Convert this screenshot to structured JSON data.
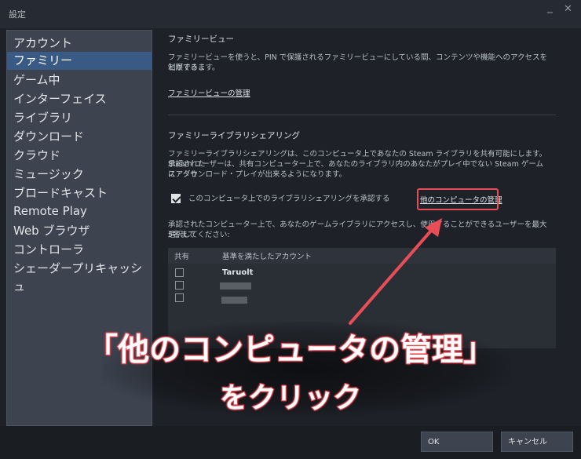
{
  "window": {
    "title": "設定",
    "minimize_glyph": "_",
    "close_glyph": "✕"
  },
  "sidebar": {
    "items": [
      {
        "label": "アカウント",
        "active": false
      },
      {
        "label": "ファミリー",
        "active": true
      },
      {
        "label": "ゲーム中",
        "active": false
      },
      {
        "label": "インターフェイス",
        "active": false
      },
      {
        "label": "ライブラリ",
        "active": false
      },
      {
        "label": "ダウンロード",
        "active": false
      },
      {
        "label": "クラウド",
        "active": false
      },
      {
        "label": "ミュージック",
        "active": false
      },
      {
        "label": "ブロードキャスト",
        "active": false
      },
      {
        "label": "Remote Play",
        "active": false
      },
      {
        "label": "Web ブラウザ",
        "active": false
      },
      {
        "label": "コントローラ",
        "active": false
      },
      {
        "label": "シェーダープリキャッシュ",
        "active": false
      }
    ]
  },
  "family_view": {
    "heading": "ファミリービュー",
    "description_line1": "ファミリービューを使うと、PIN で保護されるファミリービューにしている間、コンテンツや機能へのアクセスを制限するこ",
    "description_line2": "とができます。",
    "manage_link": "ファミリービューの管理"
  },
  "family_sharing": {
    "heading": "ファミリーライブラリシェアリング",
    "description_line1": "ファミリーライブラリシェアリングは、このコンピュータ上であなたの Steam ライブラリを共有可能にします。承認された",
    "description_line2": "Steam ユーザーは、共有コンピューター上で、あなたのライブラリ内のあなたがプレイ中でない Steam ゲームにアクセ",
    "description_line3": "ス・ダウンロード・プレイが出来るようになります。",
    "authorize_checkbox_label": "このコンピュータ上でのライブラリシェアリングを承認する",
    "authorize_checked": true,
    "other_computers_link": "他のコンピュータの管理",
    "accounts_description_line1": "承認されたコンピューター上で、あなたのゲームライブラリにアクセスし、使用することができるユーザーを最大5名まで",
    "accounts_description_line2": "選択してください:",
    "table": {
      "col_share": "共有",
      "col_account": "基準を満たしたアカウント",
      "rows": [
        {
          "account": "Taruolt",
          "checked": false
        },
        {
          "account": "",
          "checked": false
        },
        {
          "account": "",
          "checked": false
        }
      ]
    }
  },
  "footer": {
    "ok_label": "OK",
    "cancel_label": "キャンセル"
  },
  "annotation": {
    "line1": "「他のコンピュータの管理」",
    "line2": "をクリック",
    "color": "#e94d56"
  },
  "colors": {
    "accent": "#3a5a86",
    "highlight": "#e94d56"
  }
}
